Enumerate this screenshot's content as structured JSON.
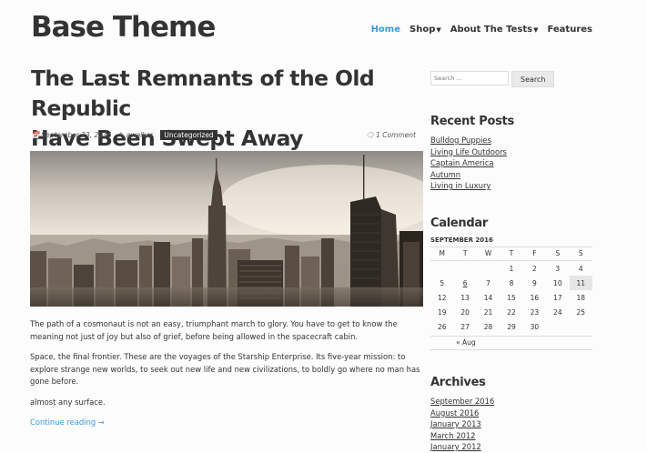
{
  "site": {
    "title": "Base Theme"
  },
  "nav": {
    "items": [
      {
        "label": "Home",
        "active": true,
        "dropdown": false
      },
      {
        "label": "Shop",
        "active": false,
        "dropdown": true
      },
      {
        "label": "About The Tests",
        "active": false,
        "dropdown": true
      },
      {
        "label": "Features",
        "active": false,
        "dropdown": false
      }
    ]
  },
  "post": {
    "title_line1": "The Last Remnants of the Old Republic",
    "title_line2": "Have Been Swept Away",
    "date": "September 23, 2016",
    "author": "awalker",
    "category": "Uncategorized",
    "comments": "1 Comment",
    "paragraphs": [
      "The path of a cosmonaut is not an easy, triumphant march to glory. You have to get to know the meaning not just of joy but also of grief, before being allowed in the spacecraft cabin.",
      "Space, the final frontier. These are the voyages of the Starship Enterprise. Its five-year mission: to explore strange new worlds, to seek out new life and new civilizations, to boldly go where no man has gone before.",
      "almost any surface."
    ],
    "continue_label": "Continue reading →",
    "image_alt": "city skyline"
  },
  "search": {
    "placeholder": "Search …",
    "button_label": "Search"
  },
  "recent_posts": {
    "title": "Recent Posts",
    "items": [
      "Bulldog Puppies",
      "Living Life Outdoors",
      "Captain America",
      "Autumn",
      "Living in Luxury"
    ]
  },
  "calendar": {
    "title": "Calendar",
    "caption": "SEPTEMBER 2016",
    "days": [
      "M",
      "T",
      "W",
      "T",
      "F",
      "S",
      "S"
    ],
    "weeks": [
      [
        "",
        "",
        "",
        "1",
        "2",
        "3",
        "4"
      ],
      [
        "5",
        "6",
        "7",
        "8",
        "9",
        "10",
        "11"
      ],
      [
        "12",
        "13",
        "14",
        "15",
        "16",
        "17",
        "18"
      ],
      [
        "19",
        "20",
        "21",
        "22",
        "23",
        "24",
        "25"
      ],
      [
        "26",
        "27",
        "28",
        "29",
        "30",
        "",
        ""
      ]
    ],
    "linked_days": [
      "6"
    ],
    "today": "11",
    "prev": "« Aug"
  },
  "archives": {
    "title": "Archives",
    "items": [
      "September 2016",
      "August 2016",
      "January 2013",
      "March 2012",
      "January 2012"
    ]
  },
  "colors": {
    "accent": "#3a9ad9",
    "text": "#333333",
    "badge": "#333333"
  },
  "icons": {
    "date": "calendar-icon",
    "author": "pencil-icon",
    "comments": "comment-icon"
  }
}
